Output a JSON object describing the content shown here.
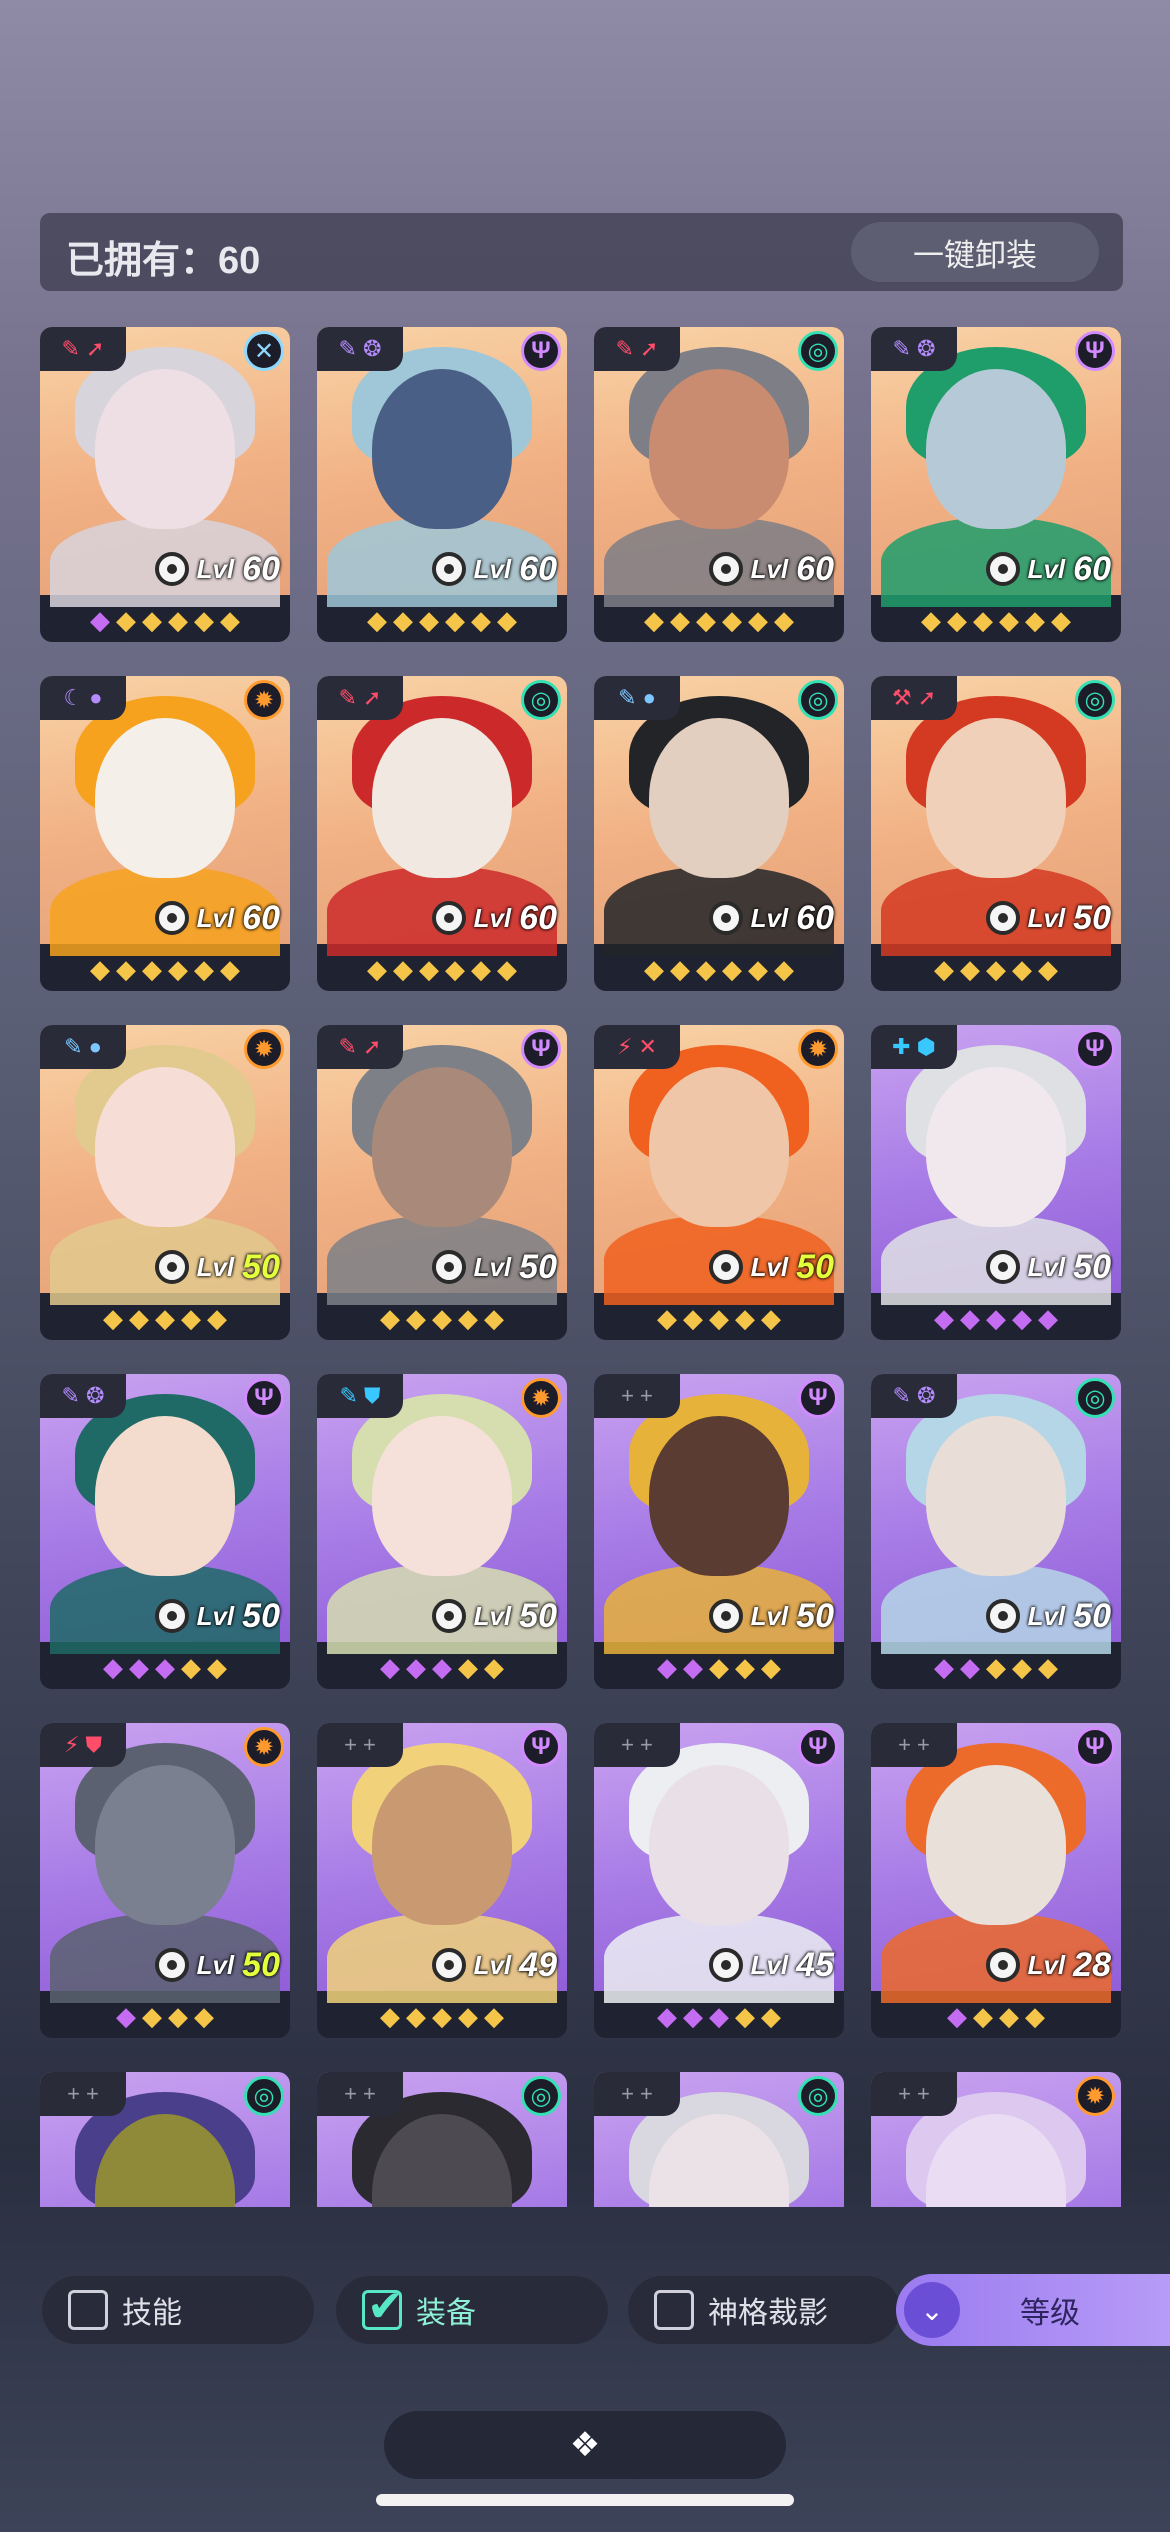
{
  "header": {
    "owned_label": "已拥有：60",
    "unequip_button": "一键卸装"
  },
  "cards": [
    {
      "level_prefix": "Lvl",
      "level": "60",
      "level_color": "#ffffff",
      "bg": "gold",
      "tag": "✎ ➚",
      "tag_color": "#ff4d6a",
      "faction": "✕",
      "faction_color": "#8fd8ff",
      "gems": [
        "p",
        "g",
        "g",
        "g",
        "g",
        "g"
      ],
      "hair": "#d8d4dc",
      "skin": "#eedfe4"
    },
    {
      "level_prefix": "Lvl",
      "level": "60",
      "level_color": "#ffffff",
      "bg": "gold",
      "tag": "✎ ❂",
      "tag_color": "#b48cff",
      "faction": "Ψ",
      "faction_color": "#d28bff",
      "gems": [
        "g",
        "g",
        "g",
        "g",
        "g",
        "g"
      ],
      "hair": "#9fc7d8",
      "skin": "#4a5f86"
    },
    {
      "level_prefix": "Lvl",
      "level": "60",
      "level_color": "#ffffff",
      "bg": "gold",
      "tag": "✎ ➚",
      "tag_color": "#ff4d6a",
      "faction": "◎",
      "faction_color": "#35e0b5",
      "gems": [
        "g",
        "g",
        "g",
        "g",
        "g",
        "g"
      ],
      "hair": "#7e7e86",
      "skin": "#c98c70"
    },
    {
      "level_prefix": "Lvl",
      "level": "60",
      "level_color": "#ffffff",
      "bg": "gold",
      "tag": "✎ ❂",
      "tag_color": "#b48cff",
      "faction": "Ψ",
      "faction_color": "#d28bff",
      "gems": [
        "g",
        "g",
        "g",
        "g",
        "g",
        "g"
      ],
      "hair": "#1f9e6c",
      "skin": "#b6c9d6"
    },
    {
      "level_prefix": "Lvl",
      "level": "60",
      "level_color": "#ffffff",
      "bg": "gold",
      "tag": "☾ ●",
      "tag_color": "#b48cff",
      "faction": "✹",
      "faction_color": "#ff9a2e",
      "gems": [
        "g",
        "g",
        "g",
        "g",
        "g",
        "g"
      ],
      "hair": "#f6a21e",
      "skin": "#f4efe8"
    },
    {
      "level_prefix": "Lvl",
      "level": "60",
      "level_color": "#ffffff",
      "bg": "gold",
      "tag": "✎ ➚",
      "tag_color": "#ff4d6a",
      "faction": "◎",
      "faction_color": "#35e0b5",
      "gems": [
        "g",
        "g",
        "g",
        "g",
        "g",
        "g"
      ],
      "hair": "#cc2a2a",
      "skin": "#f1e8e2"
    },
    {
      "level_prefix": "Lvl",
      "level": "60",
      "level_color": "#ffffff",
      "bg": "gold",
      "tag": "✎ ●",
      "tag_color": "#7ec6ff",
      "faction": "◎",
      "faction_color": "#35e0b5",
      "gems": [
        "g",
        "g",
        "g",
        "g",
        "g",
        "g"
      ],
      "hair": "#222428",
      "skin": "#e3cfc0"
    },
    {
      "level_prefix": "Lvl",
      "level": "50",
      "level_color": "#ffffff",
      "bg": "gold",
      "tag": "⚒ ➚",
      "tag_color": "#ff4d6a",
      "faction": "◎",
      "faction_color": "#35e0b5",
      "gems": [
        "g",
        "g",
        "g",
        "g",
        "g"
      ],
      "hair": "#d43a22",
      "skin": "#f0d0b8"
    },
    {
      "level_prefix": "Lvl",
      "level": "50",
      "level_color": "#e4ff3c",
      "bg": "gold",
      "tag": "✎ ●",
      "tag_color": "#7ec6ff",
      "faction": "✹",
      "faction_color": "#ff9a2e",
      "gems": [
        "g",
        "g",
        "g",
        "g",
        "g"
      ],
      "hair": "#e2c98d",
      "skin": "#f6ddd6"
    },
    {
      "level_prefix": "Lvl",
      "level": "50",
      "level_color": "#ffffff",
      "bg": "gold",
      "tag": "✎ ➚",
      "tag_color": "#ff4d6a",
      "faction": "Ψ",
      "faction_color": "#d28bff",
      "gems": [
        "g",
        "g",
        "g",
        "g",
        "g"
      ],
      "hair": "#7d8087",
      "skin": "#a98a7a"
    },
    {
      "level_prefix": "Lvl",
      "level": "50",
      "level_color": "#e4ff3c",
      "bg": "gold",
      "tag": "⚡ ✕",
      "tag_color": "#ff4d6a",
      "faction": "✹",
      "faction_color": "#ff9a2e",
      "gems": [
        "g",
        "g",
        "g",
        "g",
        "g"
      ],
      "hair": "#f0601e",
      "skin": "#efc6a8"
    },
    {
      "level_prefix": "Lvl",
      "level": "50",
      "level_color": "#ffffff",
      "bg": "purple",
      "tag": "✚ ⬢",
      "tag_color": "#38c8ff",
      "faction": "Ψ",
      "faction_color": "#d28bff",
      "gems": [
        "p",
        "p",
        "p",
        "p",
        "p"
      ],
      "hair": "#dfe0e4",
      "skin": "#f0e8ec"
    },
    {
      "level_prefix": "Lvl",
      "level": "50",
      "level_color": "#ffffff",
      "bg": "purple",
      "tag": "✎ ❂",
      "tag_color": "#b48cff",
      "faction": "Ψ",
      "faction_color": "#d28bff",
      "gems": [
        "p",
        "p",
        "p",
        "g",
        "g"
      ],
      "hair": "#1f6a66",
      "skin": "#f3dccd"
    },
    {
      "level_prefix": "Lvl",
      "level": "50",
      "level_color": "#ffffff",
      "bg": "purple",
      "tag": "✎ ⛊",
      "tag_color": "#38c8ff",
      "faction": "✹",
      "faction_color": "#ff9a2e",
      "gems": [
        "p",
        "p",
        "p",
        "g",
        "g"
      ],
      "hair": "#d6deb0",
      "skin": "#f5e1da"
    },
    {
      "level_prefix": "Lvl",
      "level": "50",
      "level_color": "#ffffff",
      "bg": "purple",
      "tag": "+ +",
      "tag_color": "#9a9aa8",
      "faction": "Ψ",
      "faction_color": "#d28bff",
      "gems": [
        "p",
        "p",
        "g",
        "g",
        "g"
      ],
      "hair": "#e7b23a",
      "skin": "#5a3c32"
    },
    {
      "level_prefix": "Lvl",
      "level": "50",
      "level_color": "#ffffff",
      "bg": "purple",
      "tag": "✎ ❂",
      "tag_color": "#b48cff",
      "faction": "◎",
      "faction_color": "#35e0b5",
      "gems": [
        "p",
        "p",
        "g",
        "g",
        "g"
      ],
      "hair": "#b5d6e6",
      "skin": "#e9ddd7"
    },
    {
      "level_prefix": "Lvl",
      "level": "50",
      "level_color": "#e4ff3c",
      "bg": "purple",
      "tag": "⚡ ⛊",
      "tag_color": "#ff4d6a",
      "faction": "✹",
      "faction_color": "#ff9a2e",
      "gems": [
        "p",
        "g",
        "g",
        "g"
      ],
      "hair": "#5b6170",
      "skin": "#7b8090"
    },
    {
      "level_prefix": "Lvl",
      "level": "49",
      "level_color": "#ffffff",
      "bg": "purple",
      "tag": "+ +",
      "tag_color": "#9a9aa8",
      "faction": "Ψ",
      "faction_color": "#d28bff",
      "gems": [
        "g",
        "g",
        "g",
        "g",
        "g"
      ],
      "hair": "#f1d27a",
      "skin": "#c99a72"
    },
    {
      "level_prefix": "Lvl",
      "level": "45",
      "level_color": "#ffffff",
      "bg": "purple",
      "tag": "+ +",
      "tag_color": "#9a9aa8",
      "faction": "Ψ",
      "faction_color": "#d28bff",
      "gems": [
        "p",
        "p",
        "p",
        "g",
        "g"
      ],
      "hair": "#eceef2",
      "skin": "#e9dfe6"
    },
    {
      "level_prefix": "Lvl",
      "level": "28",
      "level_color": "#ffffff",
      "bg": "purple",
      "tag": "+ +",
      "tag_color": "#9a9aa8",
      "faction": "Ψ",
      "faction_color": "#d28bff",
      "gems": [
        "p",
        "g",
        "g",
        "g"
      ],
      "hair": "#ec6a2a",
      "skin": "#e9e0da"
    },
    {
      "level_prefix": "",
      "level": "",
      "level_color": "#ffffff",
      "bg": "purple",
      "tag": "+ +",
      "tag_color": "#9a9aa8",
      "faction": "◎",
      "faction_color": "#35e0b5",
      "gems": [],
      "hair": "#4a3f8a",
      "skin": "#8e8a3a"
    },
    {
      "level_prefix": "",
      "level": "",
      "level_color": "#ffffff",
      "bg": "purple",
      "tag": "+ +",
      "tag_color": "#9a9aa8",
      "faction": "◎",
      "faction_color": "#35e0b5",
      "gems": [],
      "hair": "#2a2a30",
      "skin": "#4d4a52"
    },
    {
      "level_prefix": "",
      "level": "",
      "level_color": "#ffffff",
      "bg": "purple",
      "tag": "+ +",
      "tag_color": "#9a9aa8",
      "faction": "◎",
      "faction_color": "#35e0b5",
      "gems": [],
      "hair": "#d9d7df",
      "skin": "#eae2e6"
    },
    {
      "level_prefix": "",
      "level": "",
      "level_color": "#ffffff",
      "bg": "purple",
      "tag": "+ +",
      "tag_color": "#9a9aa8",
      "faction": "✹",
      "faction_color": "#ff9a2e",
      "gems": [],
      "hair": "#ddc8f0",
      "skin": "#eadcf2"
    }
  ],
  "filters": {
    "skill": {
      "label": "技能",
      "checked": false
    },
    "equipment": {
      "label": "装备",
      "checked": true
    },
    "divine_projection": {
      "label": "神格裁影",
      "checked": false
    }
  },
  "sort_button": {
    "label": "等级",
    "icon": "double-chevron-down-icon"
  },
  "bottom_tab": {
    "icon": "diamond-cluster-icon",
    "glyph": "❖"
  }
}
